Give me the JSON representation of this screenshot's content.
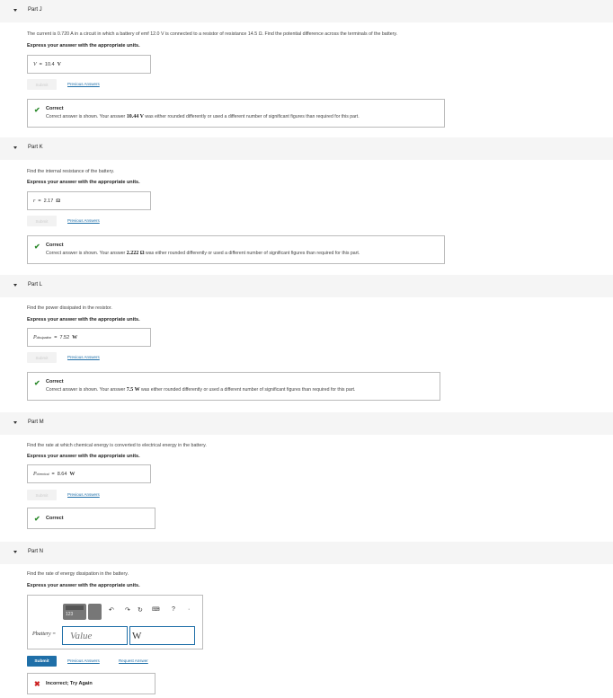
{
  "part_j": {
    "title": "Part J",
    "question": "The current is 0.720 A in a circuit in which a battery of emf 12.0 V is connected to a resistor of resistance 14.5 Ω. Find the potential difference across the terminals of the battery.",
    "express": "Express your answer with the appropriate units.",
    "answer_lhs": "V",
    "answer_value": "10.4",
    "answer_unit": "V",
    "submit_label": "Submit",
    "prev_label": "Previous Answers",
    "fb_title": "Correct",
    "fb_pre": "Correct answer is shown. Your answer",
    "fb_value": "10.44 V",
    "fb_post": "was either rounded differently or used a different number of significant figures than required for this part."
  },
  "part_k": {
    "title": "Part K",
    "question": "Find the internal resistance of the battery.",
    "express": "Express your answer with the appropriate units.",
    "answer_lhs": "r",
    "answer_value": "2.17",
    "answer_unit": "Ω",
    "submit_label": "Submit",
    "prev_label": "Previous Answers",
    "fb_title": "Correct",
    "fb_pre": "Correct answer is shown. Your answer",
    "fb_value": "2.222 Ω",
    "fb_post": "was either rounded differently or used a different number of significant figures than required for this part."
  },
  "part_l": {
    "title": "Part L",
    "question": "Find the power dissipated in the resistor.",
    "express": "Express your answer with the appropriate units.",
    "answer_lhs": "P",
    "answer_sub": "dissipation",
    "answer_value": "7.52",
    "answer_unit": "W",
    "submit_label": "Submit",
    "prev_label": "Previous Answers",
    "fb_title": "Correct",
    "fb_pre": "Correct answer is shown. Your answer",
    "fb_value": "7.5 W",
    "fb_post": "was either rounded differently or used a different number of significant figures than required for this part."
  },
  "part_m": {
    "title": "Part M",
    "question": "Find the rate at which chemical energy is converted to electrical energy in the battery.",
    "express": "Express your answer with the appropriate units.",
    "answer_lhs": "P",
    "answer_sub": "chemical",
    "answer_value": "8.64",
    "answer_unit": "W",
    "submit_label": "Submit",
    "prev_label": "Previous Answers",
    "fb_title": "Correct"
  },
  "part_n": {
    "title": "Part N",
    "question": "Find the rate of energy dissipation in the battery.",
    "express": "Express your answer with the appropriate units.",
    "answer_lhs": "P",
    "answer_sub": "battery",
    "value_placeholder": "Value",
    "unit_value": "W",
    "submit_label": "Submit",
    "prev_label": "Previous Answers",
    "request_label": "Request Answer",
    "fb_title": "Incorrect; Try Again",
    "toolbar_text": "123"
  },
  "colors": {
    "accent": "#1f6fa8",
    "correct": "#2e8b2e",
    "incorrect": "#cc2222"
  }
}
